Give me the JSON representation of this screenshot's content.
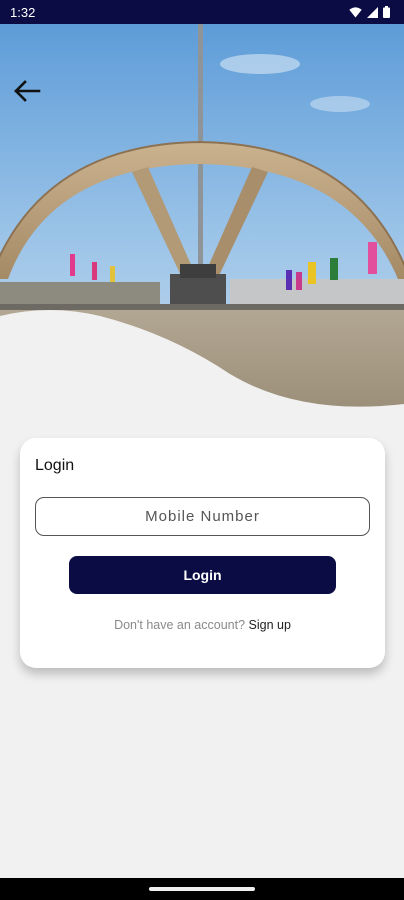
{
  "status_bar": {
    "time": "1:32",
    "icons": [
      "wifi-icon",
      "signal-icon",
      "battery-icon"
    ]
  },
  "header": {
    "back_icon": "arrow-left-icon",
    "hero_image": "monument-arch-photo"
  },
  "login_card": {
    "title": "Login",
    "mobile_placeholder": "Mobile Number",
    "mobile_value": "",
    "login_button": "Login",
    "signup_prompt": "Don't have an account?",
    "signup_link": "Sign up"
  },
  "colors": {
    "primary": "#0c0c45",
    "background": "#f1f1f1",
    "card": "#ffffff"
  }
}
